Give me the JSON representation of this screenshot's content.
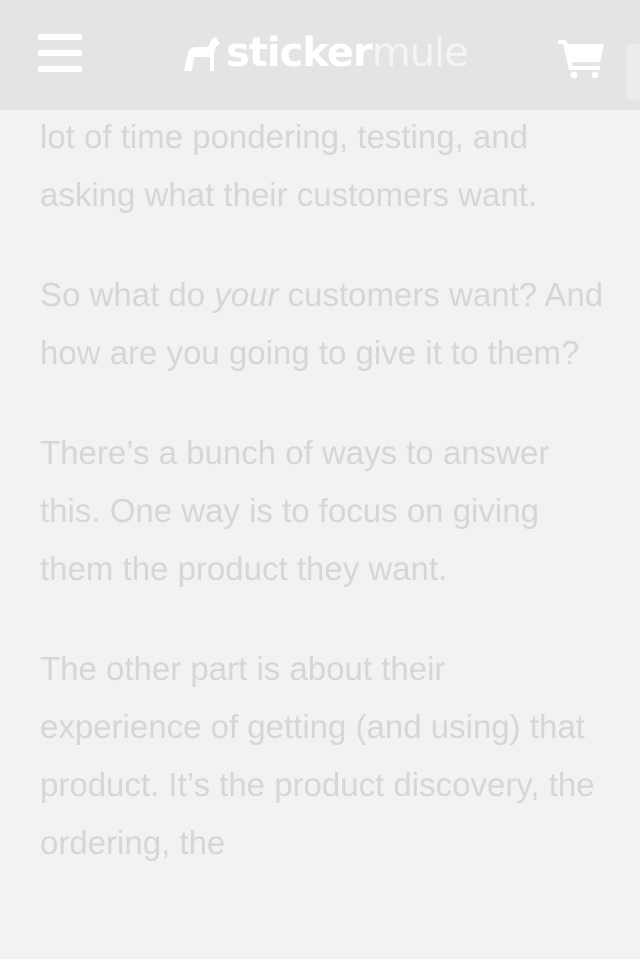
{
  "header": {
    "brand_bold": "sticker",
    "brand_light": "mule",
    "menu_icon": "hamburger-icon",
    "cart_icon": "shopping-cart-icon"
  },
  "article": {
    "p1": "lot of time pondering, testing, and asking what their customers want.",
    "p2_before": "So what do ",
    "p2_em": "your",
    "p2_after": " customers want? And how are you going to give it to them?",
    "p3": "There’s a bunch of ways to answer this. One way is to focus on giving them the product they want.",
    "p4": "The other part is about their experience of getting (and using) that product. It’s the product discovery, the ordering, the"
  },
  "colors": {
    "header_bg": "#e4e4e4",
    "page_bg": "#f2f2f2",
    "text": "#d6d6d6",
    "icons": "#ffffff"
  }
}
